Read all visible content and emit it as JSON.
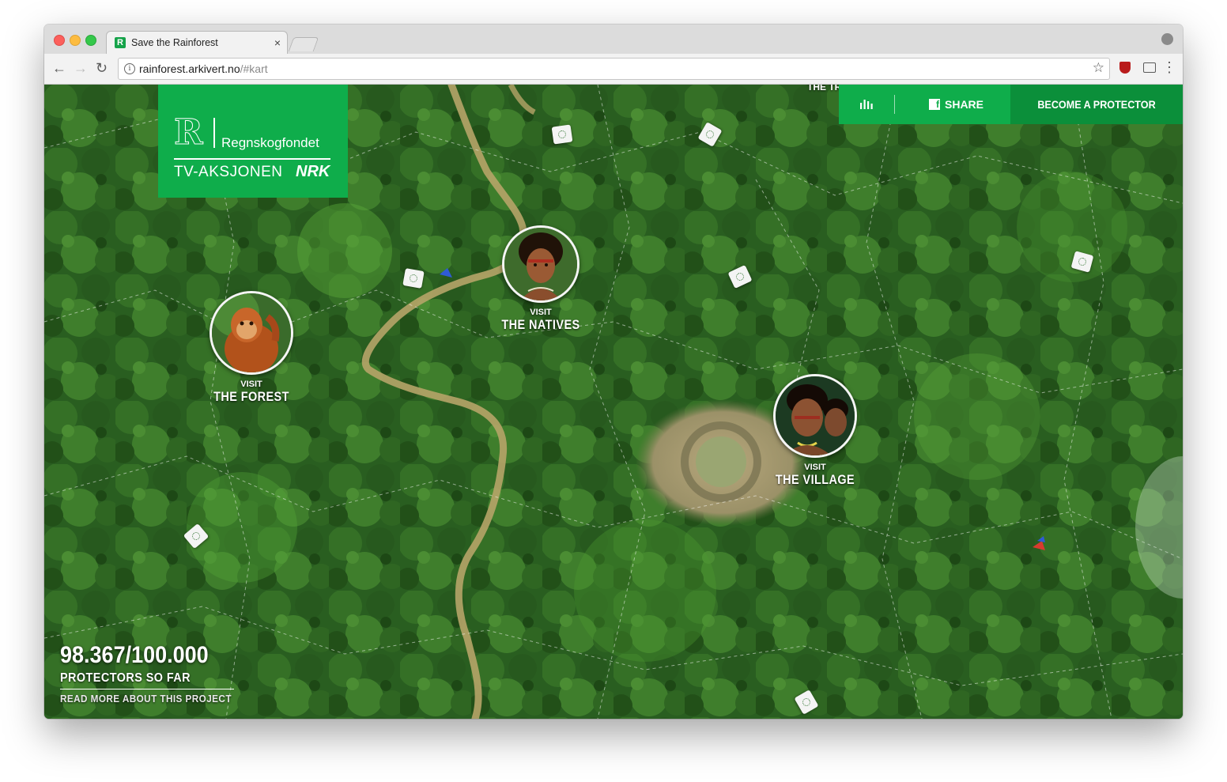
{
  "browser": {
    "tab_title": "Save the Rainforest",
    "tab_favicon": "R",
    "tab_close": "×",
    "url_host": "rainforest.arkivert.no",
    "url_path": "/#kart",
    "back_icon": "←",
    "forward_icon": "→",
    "reload_icon": "↻",
    "star_icon": "☆",
    "menu_icon": "⋮",
    "info_icon": "i"
  },
  "logo": {
    "mark": "R",
    "name": "Regnskogfondet",
    "campaign": "TV-AKSJONEN",
    "broadcaster": "NRK"
  },
  "topbar": {
    "share_label": "SHARE",
    "facebook_glyph": "f",
    "protector_label": "BECOME A PROTECTOR"
  },
  "markers": [
    {
      "visit": "VISIT",
      "title": "THE FOREST"
    },
    {
      "visit": "VISIT",
      "title": "THE NATIVES"
    },
    {
      "visit": "VISIT",
      "title": "THE VILLAGE"
    }
  ],
  "top_partial_label": "THE TR",
  "counter": {
    "value": "98.367/100.000",
    "label": "PROTECTORS SO FAR",
    "link": "READ MORE ABOUT THIS PROJECT"
  },
  "colors": {
    "brand_green": "#0fad4b",
    "brand_green_dark": "#0b8f3a"
  }
}
